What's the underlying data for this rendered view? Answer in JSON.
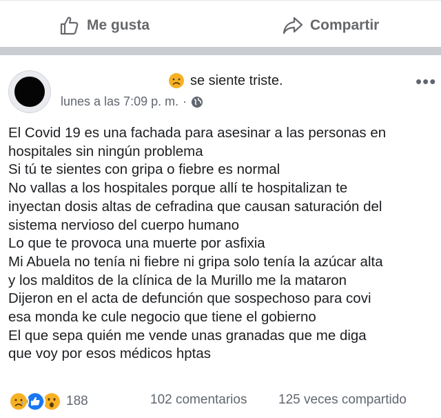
{
  "actions": {
    "like_label": "Me gusta",
    "share_label": "Compartir"
  },
  "post": {
    "feeling_text": "se siente triste.",
    "timestamp": "lunes a las 7:09 p. m.",
    "dot": "·",
    "body_lines": [
      "El Covid 19 es una fachada para asesinar a las personas en",
      "hospitales sin ningún problema",
      "Si tú te sientes con gripa o fiebre es normal",
      "No vallas a los hospitales porque allí te hospitalizan te",
      "inyectan dosis altas de cefradina que causan saturación del",
      "sistema nervioso del cuerpo humano",
      "Lo que te provoca una muerte por asfixia",
      "Mi Abuela no tenía ni fiebre ni gripa solo tenía la azúcar alta",
      "y los malditos de la clínica de la Murillo me la mataron",
      "Dijeron en el acta de defunción que sospechoso para covi",
      "esa monda ke cule negocio que tiene el gobierno",
      "El que sepa quién me vende unas granadas que me diga",
      "que voy por esos médicos hptas"
    ],
    "reaction_count": "188",
    "comments_text": "102 comentarios",
    "shares_text": "125 veces compartido"
  },
  "icons": {
    "like": "thumbs-up-icon",
    "share": "share-arrow-icon",
    "feeling": "sad-face-emoji",
    "privacy": "globe-icon",
    "more": "more-options-icon",
    "reactions": [
      "sad-reaction",
      "like-reaction",
      "wow-reaction"
    ]
  },
  "colors": {
    "text": "#1c1e21",
    "muted": "#65676b",
    "separator": "#c9ccd1",
    "like_blue": "#1877f2",
    "emoji_yellow": "#f7b125"
  }
}
